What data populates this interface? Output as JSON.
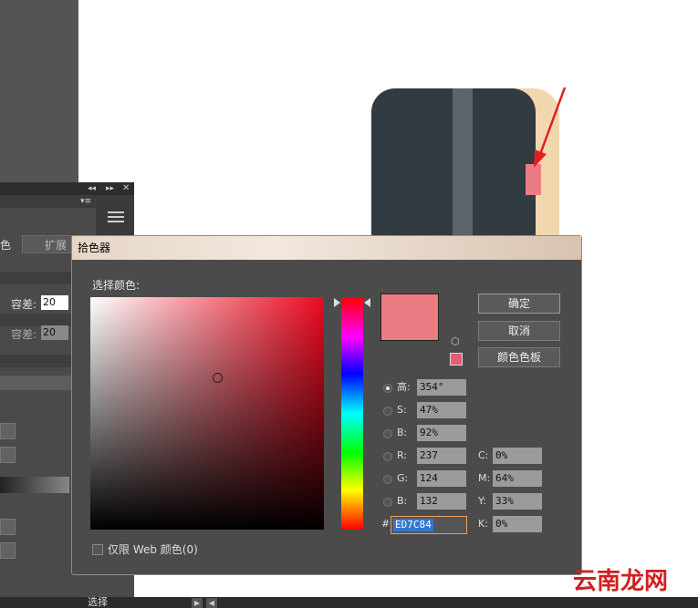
{
  "panel": {
    "expand_label": "扩展",
    "tolerance_label_1": "容差:",
    "tolerance_value_1": "20",
    "tolerance_label_2": "容差:",
    "tolerance_value_2": "20",
    "side_fragment": "色"
  },
  "status_bar": {
    "text": "选择"
  },
  "dialog": {
    "title": "拾色器",
    "prompt": "选择颜色:",
    "current_color": "#ec7c84",
    "buttons": {
      "ok": "确定",
      "cancel": "取消",
      "swatches": "颜色色板"
    },
    "fields": {
      "h_label": "高:",
      "h_value": "354°",
      "s_label": "S:",
      "s_value": "47%",
      "b_label": "B:",
      "b_value": "92%",
      "r_label": "R:",
      "r_value": "237",
      "g_label": "G:",
      "g_value": "124",
      "b2_label": "B:",
      "b2_value": "132",
      "c_label": "C:",
      "c_value": "0%",
      "m_label": "M:",
      "m_value": "64%",
      "y_label": "Y:",
      "y_value": "33%",
      "k_label": "K:",
      "k_value": "0%",
      "hex_label": "#",
      "hex_value": "ED7C84"
    },
    "web_only_label": "仅限 Web 颜色(0)"
  },
  "watermark": {
    "text": "云南龙网"
  }
}
